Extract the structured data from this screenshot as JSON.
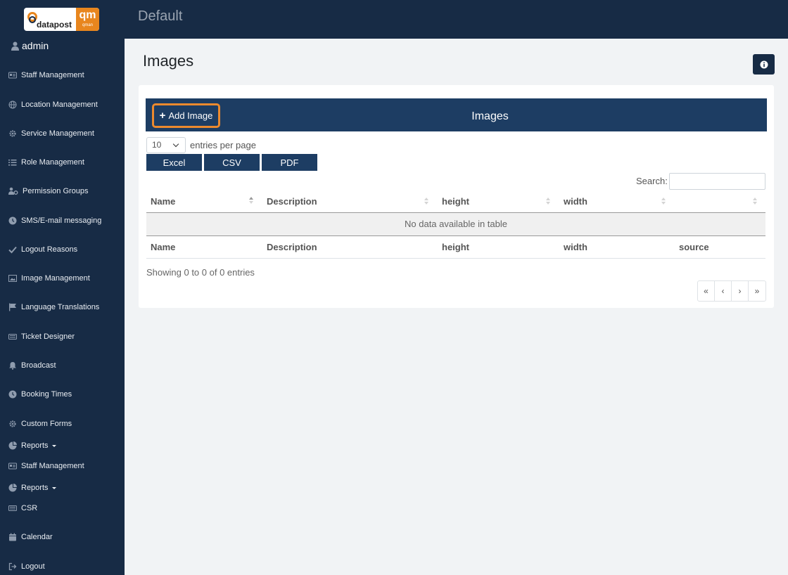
{
  "app": {
    "title": "Default",
    "user": "admin"
  },
  "logo": {
    "brand": "datapost",
    "mark": "qm",
    "sub": "qman"
  },
  "sidebar": {
    "items": [
      {
        "label": "Staff Management",
        "icon": "id-card-icon"
      },
      {
        "label": "Location Management",
        "icon": "globe-icon"
      },
      {
        "label": "Service Management",
        "icon": "gear-icon"
      },
      {
        "label": "Role Management",
        "icon": "list-icon"
      },
      {
        "label": "Permission Groups",
        "icon": "users-cog-icon"
      },
      {
        "label": "SMS/E-mail messaging",
        "icon": "clock-icon"
      },
      {
        "label": "Logout Reasons",
        "icon": "check-icon"
      },
      {
        "label": "Image Management",
        "icon": "image-icon"
      },
      {
        "label": "Language Translations",
        "icon": "flag-icon"
      },
      {
        "label": "Ticket Designer",
        "icon": "keyboard-icon"
      },
      {
        "label": "Broadcast",
        "icon": "bell-icon"
      },
      {
        "label": "Booking Times",
        "icon": "clock-icon"
      },
      {
        "label": "Custom Forms",
        "icon": "gear-icon"
      },
      {
        "label": "Reports",
        "icon": "chart-pie-icon"
      },
      {
        "label": "Staff Management",
        "icon": "id-card-icon"
      },
      {
        "label": "Reports",
        "icon": "chart-pie-icon"
      },
      {
        "label": "CSR",
        "icon": "keyboard-icon"
      },
      {
        "label": "Calendar",
        "icon": "calendar-icon"
      },
      {
        "label": "Logout",
        "icon": "sign-out-icon"
      }
    ]
  },
  "page": {
    "title": "Images"
  },
  "card": {
    "header": "Images",
    "add_button": "Add Image",
    "length": {
      "value": "10",
      "label": "entries per page"
    },
    "export": [
      "Excel",
      "CSV",
      "PDF"
    ],
    "search_label": "Search:",
    "columns": [
      "Name",
      "Description",
      "height",
      "width",
      ""
    ],
    "footer_columns": [
      "Name",
      "Description",
      "height",
      "width",
      "source"
    ],
    "empty": "No data available in table",
    "info": "Showing 0 to 0 of 0 entries",
    "pager": [
      "«",
      "‹",
      "›",
      "»"
    ]
  },
  "colors": {
    "navy": "#172b45",
    "header": "#1d3d63",
    "accent": "#ec8a2e"
  }
}
